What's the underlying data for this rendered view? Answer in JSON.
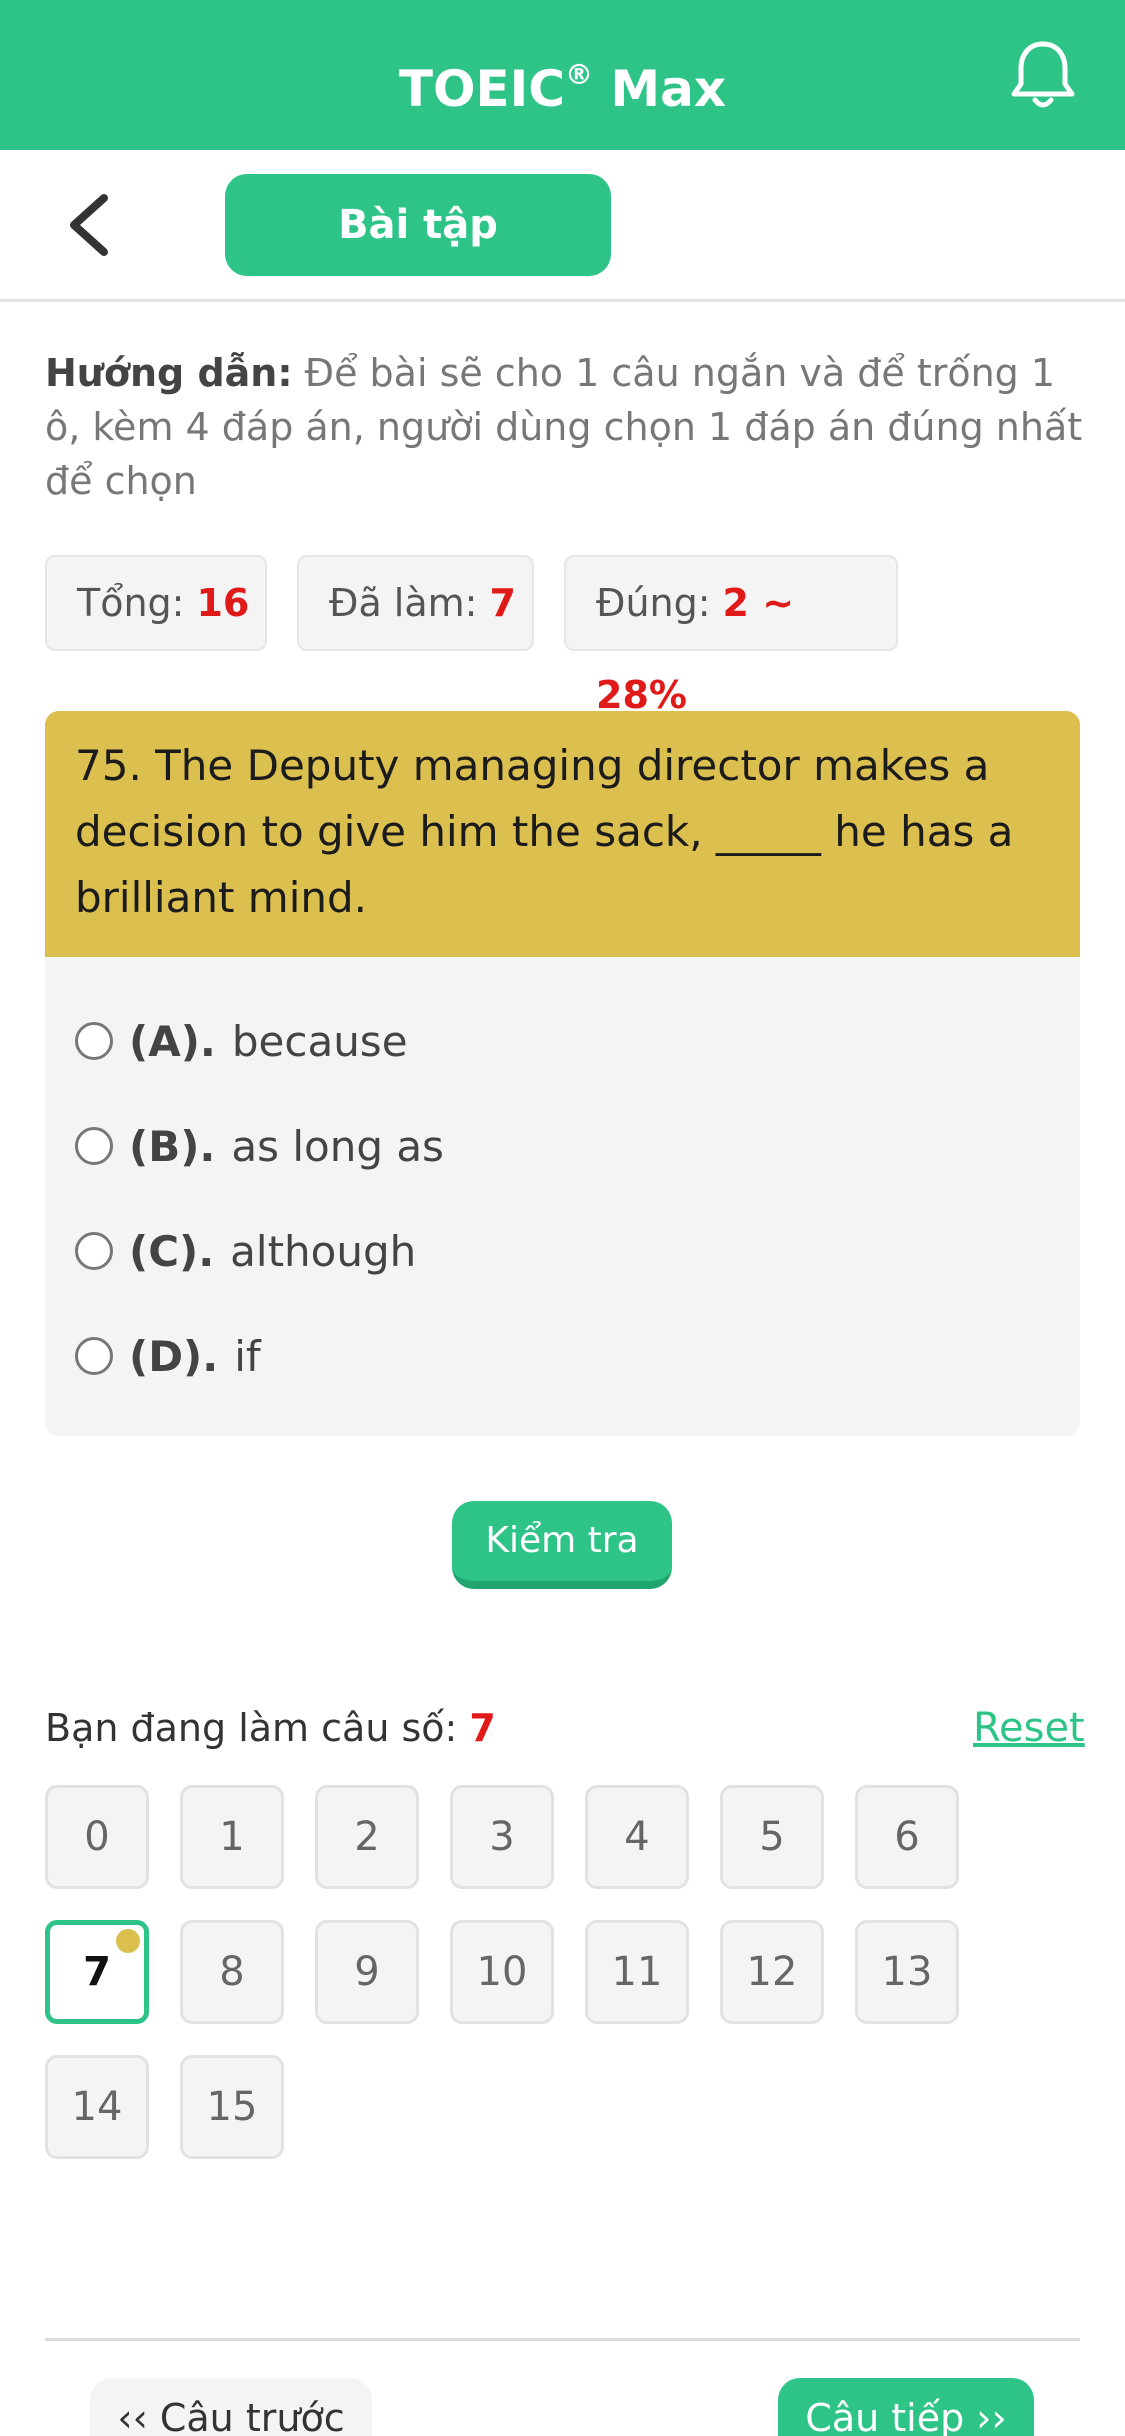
{
  "app": {
    "title": "TOEIC",
    "title_mark": "®",
    "title_suffix": " Max"
  },
  "subnav": {
    "tab_label": "Bài tập"
  },
  "guide": {
    "label": "Hướng dẫn:",
    "text": " Để bài sẽ cho 1 câu ngắn và để trống 1 ô, kèm 4 đáp án, người dùng chọn 1 đáp án đúng nhất để chọn"
  },
  "stats": {
    "total_label": "Tổng:",
    "total_value": "16",
    "done_label": "Đã làm:",
    "done_value": "7",
    "correct_label": "Đúng:",
    "correct_value": "2 ~ 28%"
  },
  "question": {
    "text": "75. The Deputy managing director makes a decision to give him the sack, _____ he has a brilliant mind.",
    "options": [
      {
        "label": "(A).",
        "text": "because"
      },
      {
        "label": "(B).",
        "text": "as long as"
      },
      {
        "label": "(C).",
        "text": "although"
      },
      {
        "label": "(D).",
        "text": "if"
      }
    ]
  },
  "check_button": "Kiểm tra",
  "progress": {
    "current_label": "Bạn đang làm câu số: ",
    "current_value": "7",
    "reset_label": "Reset",
    "numbers": [
      "0",
      "1",
      "2",
      "3",
      "4",
      "5",
      "6",
      "7",
      "8",
      "9",
      "10",
      "11",
      "12",
      "13",
      "14",
      "15"
    ]
  },
  "footer": {
    "prev_label": "‹‹ Câu trước",
    "next_label": "Câu tiếp ››"
  },
  "colors": {
    "brand": "#2ec487",
    "question_bg": "#dbbf4f",
    "accent_red": "#e01919"
  }
}
